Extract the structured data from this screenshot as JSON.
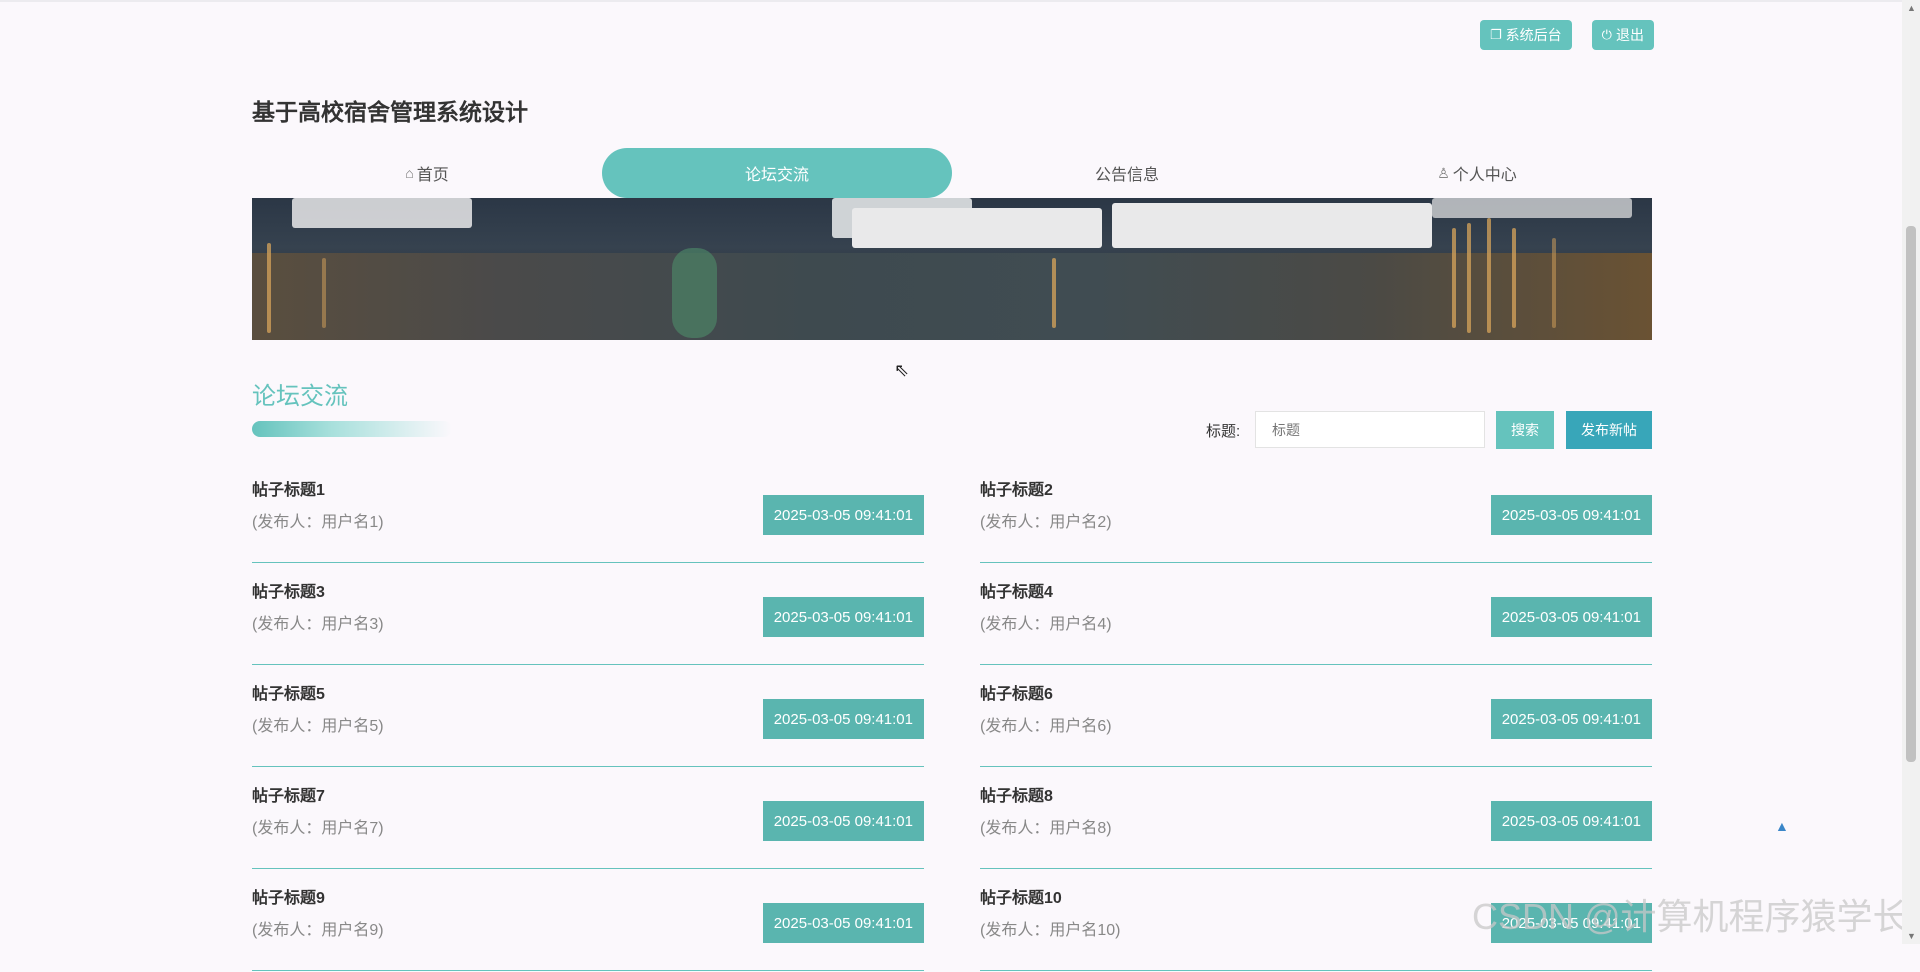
{
  "header": {
    "admin_button": "系统后台",
    "logout_button": "退出",
    "site_title": "基于高校宿舍管理系统设计"
  },
  "nav": {
    "items": [
      {
        "label": "首页",
        "icon": "home-icon"
      },
      {
        "label": "论坛交流",
        "icon": ""
      },
      {
        "label": "公告信息",
        "icon": ""
      },
      {
        "label": "个人中心",
        "icon": "user-icon"
      }
    ],
    "active": "论坛交流"
  },
  "section": {
    "title": "论坛交流"
  },
  "search": {
    "label": "标题:",
    "placeholder": "标题",
    "search_button": "搜索",
    "new_post_button": "发布新帖"
  },
  "posts": [
    {
      "title": "帖子标题1",
      "author": "(发布人：用户名1)",
      "time": "2025-03-05 09:41:01"
    },
    {
      "title": "帖子标题2",
      "author": "(发布人：用户名2)",
      "time": "2025-03-05 09:41:01"
    },
    {
      "title": "帖子标题3",
      "author": "(发布人：用户名3)",
      "time": "2025-03-05 09:41:01"
    },
    {
      "title": "帖子标题4",
      "author": "(发布人：用户名4)",
      "time": "2025-03-05 09:41:01"
    },
    {
      "title": "帖子标题5",
      "author": "(发布人：用户名5)",
      "time": "2025-03-05 09:41:01"
    },
    {
      "title": "帖子标题6",
      "author": "(发布人：用户名6)",
      "time": "2025-03-05 09:41:01"
    },
    {
      "title": "帖子标题7",
      "author": "(发布人：用户名7)",
      "time": "2025-03-05 09:41:01"
    },
    {
      "title": "帖子标题8",
      "author": "(发布人：用户名8)",
      "time": "2025-03-05 09:41:01"
    },
    {
      "title": "帖子标题9",
      "author": "(发布人：用户名9)",
      "time": "2025-03-05 09:41:01"
    },
    {
      "title": "帖子标题10",
      "author": "(发布人：用户名10)",
      "time": "2025-03-05 09:41:01"
    }
  ],
  "watermark": "CSDN @计算机程序猿学长",
  "colors": {
    "accent": "#65c3bd",
    "new_post": "#38a6b9",
    "time_badge": "#5ab5af",
    "background": "#fbf8fc"
  }
}
